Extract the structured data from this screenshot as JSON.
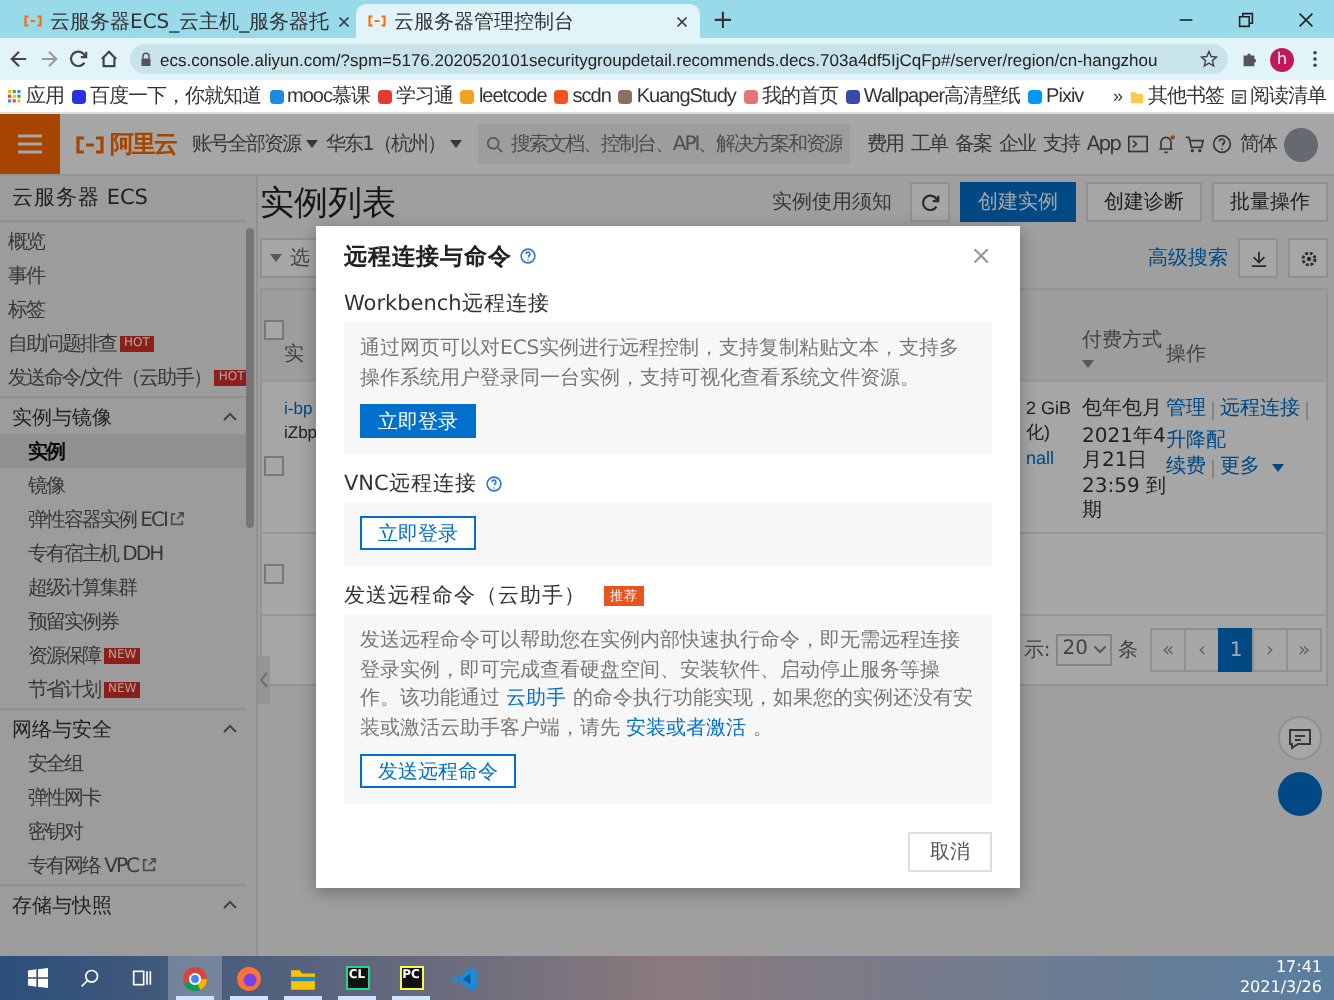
{
  "browser": {
    "tabs": [
      {
        "title": "云服务器ECS_云主机_服务器托",
        "selected": false
      },
      {
        "title": "云服务器管理控制台",
        "selected": true
      }
    ],
    "new_tab": "+",
    "url": "ecs.console.aliyun.com/?spm=5176.2020520101securitygroupdetail.recommends.decs.703a4df5IjCqFp#/server/region/cn-hangzhou",
    "profile_initial": "h"
  },
  "bookmarks": {
    "apps": "应用",
    "items": [
      {
        "label": "百度一下，你就知道",
        "color": "#2932e1"
      },
      {
        "label": "mooc慕课",
        "color": "#1e88e5"
      },
      {
        "label": "学习通",
        "color": "#e53935"
      },
      {
        "label": "leetcode",
        "color": "#f0a31c"
      },
      {
        "label": "scdn",
        "color": "#f4511e"
      },
      {
        "label": "KuangStudy",
        "color": "#8d6e63"
      },
      {
        "label": "我的首页",
        "color": "#e57373"
      },
      {
        "label": "Wallpaper高清壁纸",
        "color": "#3949ab"
      },
      {
        "label": "Pixiv",
        "color": "#0096fa"
      }
    ],
    "more": "»",
    "other": "其他书签",
    "reading_list": "阅读清单"
  },
  "console_header": {
    "logo": "阿里云",
    "account_scope": "账号全部资源",
    "region": "华东1（杭州）",
    "search_placeholder": "搜索文档、控制台、API、解决方案和资源",
    "nav": [
      "费用",
      "工单",
      "备案",
      "企业",
      "支持",
      "App"
    ],
    "language": "简体"
  },
  "sidebar": {
    "title": "云服务器 ECS",
    "sections": [
      {
        "items": [
          {
            "label": "概览",
            "selected": false,
            "external": false
          },
          {
            "label": "事件",
            "selected": false,
            "external": false
          },
          {
            "label": "标签",
            "selected": false,
            "external": false
          },
          {
            "label": "自助问题排查",
            "badge": "HOT",
            "selected": false,
            "external": false
          },
          {
            "label": "发送命令/文件（云助手）",
            "badge": "HOT",
            "selected": false,
            "external": false
          }
        ]
      },
      {
        "title": "实例与镜像",
        "expanded": true,
        "items": [
          {
            "label": "实例",
            "selected": true,
            "external": false
          },
          {
            "label": "镜像",
            "selected": false,
            "external": false
          },
          {
            "label": "弹性容器实例 ECI",
            "selected": false,
            "external": true
          },
          {
            "label": "专有宿主机 DDH",
            "selected": false,
            "external": false
          },
          {
            "label": "超级计算集群",
            "selected": false,
            "external": false
          },
          {
            "label": "预留实例券",
            "selected": false,
            "external": false
          },
          {
            "label": "资源保障",
            "badge": "NEW",
            "selected": false,
            "external": false
          },
          {
            "label": "节省计划",
            "badge": "NEW",
            "selected": false,
            "external": false
          }
        ]
      },
      {
        "title": "网络与安全",
        "expanded": true,
        "items": [
          {
            "label": "安全组",
            "selected": false,
            "external": false
          },
          {
            "label": "弹性网卡",
            "selected": false,
            "external": false
          },
          {
            "label": "密钥对",
            "selected": false,
            "external": false
          },
          {
            "label": "专有网络 VPC",
            "selected": false,
            "external": true
          }
        ]
      },
      {
        "title": "存储与快照",
        "expanded": true
      }
    ]
  },
  "main": {
    "title": "实例列表",
    "notice_link": "实例使用须知",
    "buttons": [
      {
        "label": "创建实例",
        "primary": true
      },
      {
        "label": "创建诊断",
        "primary": false
      },
      {
        "label": "批量操作",
        "primary": false
      }
    ],
    "filter_label": "选",
    "advanced_search": "高级搜索",
    "table": {
      "header_checked": false,
      "columns": [
        {
          "label": "实"
        },
        {
          "label": "付费方式",
          "sortable": true
        },
        {
          "label": "操作"
        }
      ],
      "rows": [
        {
          "checked": false,
          "instance_id": "i-bp",
          "hostname": "iZbp",
          "spec": "2 GiB",
          "spec_note": "化)",
          "spec_link": "nall",
          "billing": "包年包月",
          "expiry": "2021年4月21日 23:59 到期",
          "actions": [
            "管理",
            "远程连接",
            "升降配"
          ],
          "actions_2": [
            "续费",
            "更多"
          ]
        }
      ],
      "footer_checked": false
    },
    "pagination": {
      "page_size_label": "示:",
      "page_size": "20",
      "unit": "条",
      "pages": [
        {
          "label": "«",
          "selected": false
        },
        {
          "label": "‹",
          "selected": false
        },
        {
          "label": "1",
          "selected": true
        },
        {
          "label": "›",
          "selected": false
        },
        {
          "label": "»",
          "selected": false
        }
      ]
    }
  },
  "dialog": {
    "title": "远程连接与命令",
    "close": "×",
    "sections": [
      {
        "heading": "Workbench远程连接",
        "help": false,
        "description": [
          {
            "text": "通过网页可以对ECS实例进行远程控制，支持复制粘贴文本，支持多操作系统用户登录同一台实例，支持可视化查看系统文件资源。",
            "link": false
          }
        ],
        "button": {
          "label": "立即登录",
          "primary": true
        }
      },
      {
        "heading": "VNC远程连接",
        "help": true,
        "button": {
          "label": "立即登录",
          "primary": false
        }
      },
      {
        "heading": "发送远程命令（云助手）",
        "help": false,
        "badge": "推荐",
        "description": [
          {
            "text": "发送远程命令可以帮助您在实例内部快速执行命令，即无需远程连接登录实例，即可完成查看硬盘空间、安装软件、启动停止服务等操作。该功能通过 ",
            "link": false
          },
          {
            "text": "云助手",
            "link": true
          },
          {
            "text": " 的命令执行功能实现，如果您的实例还没有安装或激活云助手客户端，请先 ",
            "link": false
          },
          {
            "text": "安装或者激活",
            "link": true
          },
          {
            "text": " 。",
            "link": false
          }
        ],
        "button": {
          "label": "发送远程命令",
          "primary": false
        }
      }
    ],
    "cancel": "取消"
  },
  "taskbar": {
    "apps": [
      {
        "kind": "chrome",
        "selected": true,
        "open": true
      },
      {
        "kind": "firefox",
        "selected": false,
        "open": true
      },
      {
        "kind": "explorer",
        "selected": false,
        "open": true
      },
      {
        "kind": "clion",
        "label": "CL",
        "selected": false,
        "open": true
      },
      {
        "kind": "pycharm",
        "label": "PC",
        "selected": false,
        "open": true
      },
      {
        "kind": "vscode",
        "selected": false,
        "open": false
      }
    ],
    "time": "17:41",
    "date": "2021/3/26"
  }
}
